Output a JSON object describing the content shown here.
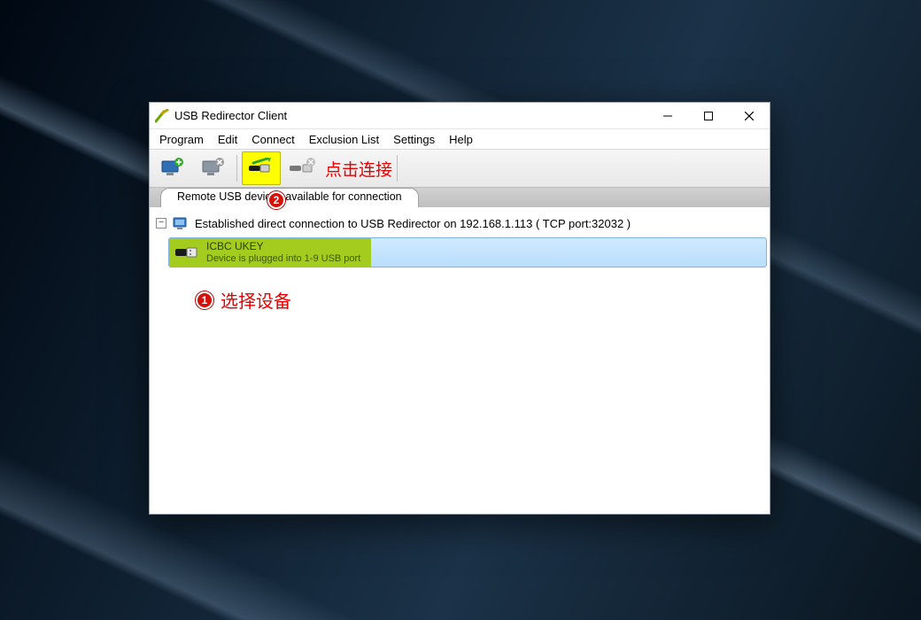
{
  "window": {
    "title": "USB Redirector Client",
    "min_tip": "Minimize",
    "max_tip": "Maximize",
    "close_tip": "Close"
  },
  "menubar": [
    "Program",
    "Edit",
    "Connect",
    "Exclusion List",
    "Settings",
    "Help"
  ],
  "toolbar": {
    "btn1_name": "add-server-button",
    "btn2_name": "remove-server-button",
    "btn3_name": "connect-device-button",
    "btn4_name": "disconnect-device-button"
  },
  "tabs": {
    "main": "Remote USB devices available for connection"
  },
  "tree": {
    "root_label": "Established direct connection to USB Redirector on 192.168.1.113 ( TCP port:32032 )",
    "device": {
      "name": "ICBC UKEY",
      "sub": "Device is plugged into 1-9 USB port"
    }
  },
  "annot": {
    "click_connect": "点击连接",
    "click_connect_badge": "2",
    "select_device": "选择设备",
    "select_device_badge": "1"
  }
}
